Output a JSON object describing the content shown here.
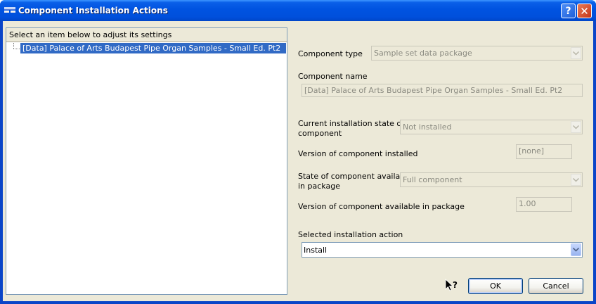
{
  "window": {
    "title": "Component Installation Actions",
    "help_glyph": "?",
    "close_glyph": "✕"
  },
  "tree": {
    "header": "Select an item below to adjust its settings",
    "items": [
      {
        "label": "[Data] Palace of Arts Budapest Pipe Organ Samples - Small Ed. Pt2",
        "selected": true
      }
    ]
  },
  "form": {
    "component_type_label": "Component type",
    "component_type_value": "Sample set data package",
    "component_name_label": "Component name",
    "component_name_value": "[Data] Palace of Arts Budapest Pipe Organ Samples - Small Ed. Pt2",
    "install_state_label_1": "Current installation state of",
    "install_state_label_2": "component",
    "install_state_value": "Not installed",
    "version_installed_label": "Version of component installed",
    "version_installed_value": "[none]",
    "available_state_label_1": "State of component available",
    "available_state_label_2": "in package",
    "available_state_value": "Full component",
    "version_available_label": "Version of component available in package",
    "version_available_value": "1.00",
    "action_label": "Selected installation action",
    "action_value": "Install"
  },
  "buttons": {
    "ok": "OK",
    "cancel": "Cancel"
  },
  "colors": {
    "titlebar": "#0053e0",
    "selection": "#316ac5",
    "dialog_bg": "#ece9d8"
  },
  "icons": [
    "window-app-icon",
    "help-icon",
    "close-icon",
    "chevron-down-icon",
    "whats-this-cursor-icon"
  ]
}
